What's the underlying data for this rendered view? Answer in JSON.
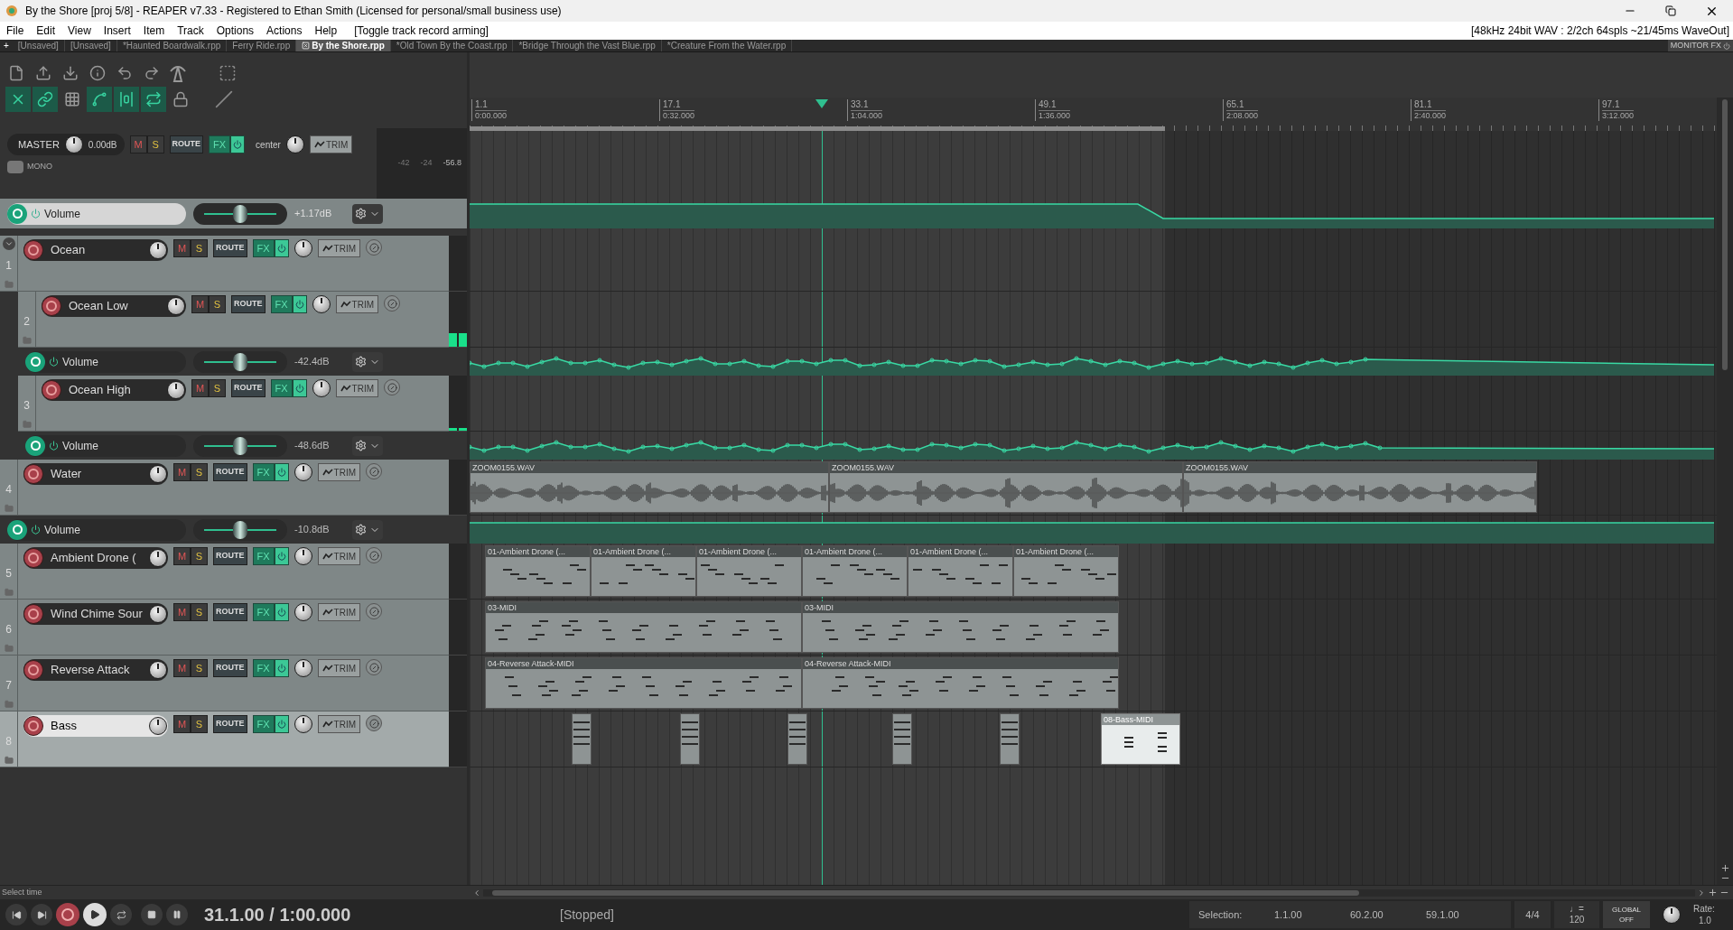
{
  "window": {
    "title": "By the Shore [proj 5/8] - REAPER v7.33 - Registered to Ethan Smith (Licensed for personal/small business use)"
  },
  "menu": {
    "items": [
      "File",
      "Edit",
      "View",
      "Insert",
      "Item",
      "Track",
      "Options",
      "Actions",
      "Help"
    ],
    "action_hint": "[Toggle track record arming]",
    "audio_status": "[48kHz 24bit WAV : 2/2ch 64spls ~21/45ms WaveOut]"
  },
  "project_tabs": {
    "new_tab": "+",
    "monitor_fx": "MONITOR FX",
    "tabs": [
      {
        "label": "[Unsaved]",
        "selected": false
      },
      {
        "label": "[Unsaved]",
        "selected": false
      },
      {
        "label": "*Haunted Boardwalk.rpp",
        "selected": false
      },
      {
        "label": "Ferry Ride.rpp",
        "selected": false
      },
      {
        "label": "By the Shore.rpp",
        "selected": true
      },
      {
        "label": "*Old  Town By the Coast.rpp",
        "selected": false
      },
      {
        "label": "*Bridge Through the Vast Blue.rpp",
        "selected": false
      },
      {
        "label": "*Creature From the Water.rpp",
        "selected": false
      }
    ]
  },
  "toolbar_toggles": [
    {
      "on": true
    },
    {
      "on": true
    },
    {
      "on": false
    },
    {
      "on": true
    },
    {
      "on": true
    },
    {
      "on": true
    },
    {
      "on": false
    }
  ],
  "master": {
    "name": "MASTER",
    "volume": "0.00dB",
    "controls": [
      "M",
      "S",
      "ROUTE",
      "FX",
      "TRIM"
    ],
    "pan": "center",
    "mono": "MONO",
    "meter_scale": [
      "-42",
      "-24"
    ],
    "peak": "-56.8",
    "envelope": {
      "label": "Volume",
      "value": "+1.17dB",
      "level": 0.5,
      "selected": true
    }
  },
  "tracks": [
    {
      "number": "1",
      "name": "Ocean",
      "selected": false,
      "muted": false,
      "soloed": false,
      "expanded": true,
      "controls": [
        "M",
        "S",
        "ROUTE",
        "FX",
        "TRIM"
      ],
      "children": [
        {
          "number": "2",
          "name": "Ocean Low",
          "selected": false,
          "muted": false,
          "soloed": false,
          "controls": [
            "M",
            "S",
            "ROUTE",
            "FX",
            "TRIM"
          ],
          "meter": {
            "level": 0.25
          },
          "envelope": {
            "label": "Volume",
            "value": "-42.4dB",
            "level": 0.5,
            "selected": false
          }
        },
        {
          "number": "3",
          "name": "Ocean High",
          "selected": false,
          "muted": false,
          "soloed": false,
          "controls": [
            "M",
            "S",
            "ROUTE",
            "FX",
            "TRIM"
          ],
          "meter": {
            "level": 0.05
          },
          "envelope": {
            "label": "Volume",
            "value": "-48.6dB",
            "level": 0.5,
            "selected": false
          }
        }
      ]
    },
    {
      "number": "4",
      "name": "Water",
      "selected": false,
      "muted": false,
      "soloed": false,
      "controls": [
        "M",
        "S",
        "ROUTE",
        "FX",
        "TRIM"
      ],
      "items": [
        {
          "kind": "audio",
          "label": "ZOOM0155.WAV",
          "selected": false
        },
        {
          "kind": "audio",
          "label": "ZOOM0155.WAV",
          "selected": false
        },
        {
          "kind": "audio",
          "label": "ZOOM0155.WAV",
          "selected": false
        }
      ],
      "envelope": {
        "label": "Volume",
        "value": "-10.8dB",
        "level": 0.5,
        "selected": false
      }
    },
    {
      "number": "5",
      "name": "Ambient Drone (",
      "selected": false,
      "muted": false,
      "soloed": false,
      "controls": [
        "M",
        "S",
        "ROUTE",
        "FX",
        "TRIM"
      ],
      "items": [
        {
          "kind": "midi",
          "label": "01-Ambient Drone (...",
          "selected": false
        },
        {
          "kind": "midi",
          "label": "01-Ambient Drone (...",
          "selected": false
        },
        {
          "kind": "midi",
          "label": "01-Ambient Drone (...",
          "selected": false
        },
        {
          "kind": "midi",
          "label": "01-Ambient Drone (...",
          "selected": false
        },
        {
          "kind": "midi",
          "label": "01-Ambient Drone (...",
          "selected": false
        },
        {
          "kind": "midi",
          "label": "01-Ambient Drone (...",
          "selected": false
        }
      ]
    },
    {
      "number": "6",
      "name": "Wind Chime Sour",
      "selected": false,
      "muted": false,
      "soloed": false,
      "controls": [
        "M",
        "S",
        "ROUTE",
        "FX",
        "TRIM"
      ],
      "items": [
        {
          "kind": "midi",
          "label": "03-MIDI",
          "selected": false
        },
        {
          "kind": "midi",
          "label": "03-MIDI",
          "selected": false
        }
      ]
    },
    {
      "number": "7",
      "name": "Reverse Attack",
      "selected": false,
      "muted": false,
      "soloed": false,
      "controls": [
        "M",
        "S",
        "ROUTE",
        "FX",
        "TRIM"
      ],
      "items": [
        {
          "kind": "midi",
          "label": "04-Reverse Attack-MIDI",
          "selected": false
        },
        {
          "kind": "midi",
          "label": "04-Reverse Attack-MIDI",
          "selected": false
        }
      ]
    },
    {
      "number": "8",
      "name": "Bass",
      "selected": true,
      "muted": false,
      "soloed": false,
      "controls": [
        "M",
        "S",
        "ROUTE",
        "FX",
        "TRIM"
      ],
      "items": [
        {
          "kind": "midi",
          "selected": false
        },
        {
          "kind": "midi",
          "selected": false
        },
        {
          "kind": "midi",
          "selected": false
        },
        {
          "kind": "midi",
          "selected": false
        },
        {
          "kind": "midi",
          "selected": false
        },
        {
          "kind": "midi",
          "label": "08-Bass-MIDI",
          "selected": true
        }
      ]
    }
  ],
  "ruler": [
    {
      "bar": "1.1",
      "time": "0:00.000"
    },
    {
      "bar": "17.1",
      "time": "0:32.000"
    },
    {
      "bar": "33.1",
      "time": "1:04.000"
    },
    {
      "bar": "49.1",
      "time": "1:36.000"
    },
    {
      "bar": "65.1",
      "time": "2:08.000"
    },
    {
      "bar": "81.1",
      "time": "2:40.000"
    },
    {
      "bar": "97.1",
      "time": "3:12.000"
    }
  ],
  "status": "Select time",
  "transport": {
    "position": "31.1.00 / 1:00.000",
    "state": "[Stopped]",
    "selection_label": "Selection:",
    "selection": [
      "1.1.00",
      "60.2.00",
      "59.1.00"
    ],
    "time_signature": "4/4",
    "tempo_symbol": "♩=",
    "tempo": "120",
    "global_label": "GLOBAL",
    "global_value": "OFF",
    "rate_label": "Rate:",
    "rate": "1.0"
  }
}
